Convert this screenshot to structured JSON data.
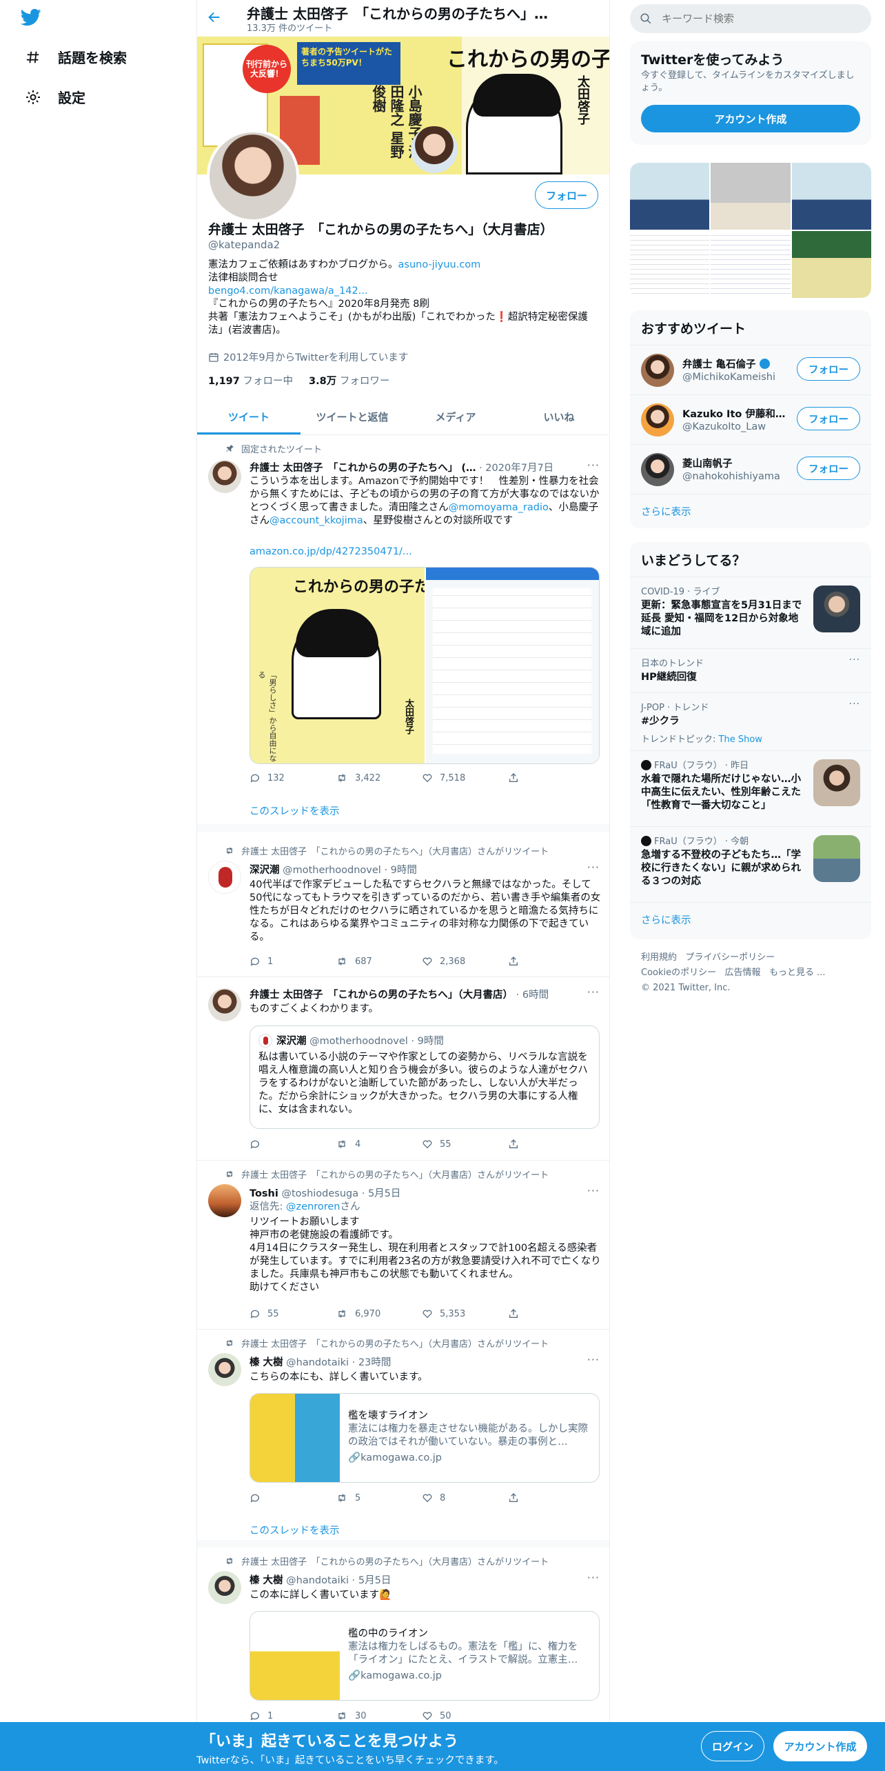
{
  "nav": {
    "explore_label": "話題を検索",
    "settings_label": "設定"
  },
  "header": {
    "title": "弁護士 太田啓子　「これからの男の子たちへ」…",
    "tweet_count": "13.3万 件のツイート"
  },
  "banner": {
    "big_title": "これからの男の子たちへ",
    "badge_text": "刊行前から大反響！",
    "badge2": "著者の予告ツイートがたちまち50万PV！",
    "names": [
      "小島慶子",
      "清田隆之",
      "星野俊樹",
      "太田啓子"
    ]
  },
  "profile": {
    "name": "弁護士 太田啓子　「これからの男の子たちへ」（大月書店）",
    "handle": "@katepanda2",
    "follow_label": "フォロー",
    "bio_line1": "憲法カフェご依頼はあすわかブログから。",
    "bio_link1": "asuno-jiyuu.com",
    "bio_line2": "法律相談問合せ",
    "bio_link2": "bengo4.com/kanagawa/a_142...",
    "bio_line3": "『これからの男の子たちへ』2020年8月発売 8刷",
    "bio_line4": "共著「憲法カフェへようこそ」(かもがわ出版)「これでわかった❗超訳特定秘密保護法」(岩波書店)。",
    "joined": "2012年9月からTwitterを利用しています",
    "following_count": "1,197",
    "following_label": "フォロー中",
    "followers_count": "3.8万",
    "followers_label": "フォロワー"
  },
  "tabs": [
    "ツイート",
    "ツイートと返信",
    "メディア",
    "いいね"
  ],
  "tweets": [
    {
      "context": "固定されたツイート",
      "name": "弁護士 太田啓子　「これからの男の子たちへ」 (…",
      "time": "· 2020年7月7日",
      "text1": "こういう本を出します。Amazonで予約開始中です！　性差別・性暴力を社会から無くすためには、子どもの頃からの男の子の育て方が大事なのではないかとつくづく思って書きました。清田隆之さん",
      "mention1": "@momoyama_radio",
      "text2": "、小島慶子さん",
      "mention2": "@account_kkojima",
      "text3": "、星野俊樹さんとの対談所収です",
      "link": "amazon.co.jp/dp/4272350471/...",
      "img_title": "これからの男の子たちへ",
      "img_side": "「男らしさ」から自由になる",
      "img_author": "太田啓子",
      "replies": "132",
      "retweets": "3,422",
      "likes": "7,518",
      "show_thread": "このスレッドを表示"
    },
    {
      "context": "弁護士 太田啓子　「これからの男の子たちへ」（大月書店）さんがリツイート",
      "name": "深沢潮",
      "handle": "@motherhoodnovel · 9時間",
      "text": "40代半ばで作家デビューした私ですらセクハラと無縁ではなかった。そして50代になってもトラウマを引きずっているのだから、若い書き手や編集者の女性たちが日々どれだけのセクハラに晒されているかを思うと暗澹たる気持ちになる。これはあらゆる業界やコミュニティの非対称な力関係の下で起きている。",
      "replies": "1",
      "retweets": "687",
      "likes": "2,368"
    },
    {
      "name": "弁護士 太田啓子　「これからの男の子たちへ」（大月書店）",
      "time": "· 6時間",
      "text": "ものすごくよくわかります。",
      "quote_name": "深沢潮",
      "quote_handle": "@motherhoodnovel · 9時間",
      "quote_text": "私は書いている小説のテーマや作家としての姿勢から、リベラルな言説を唱え人権意識の高い人と知り合う機会が多い。彼らのような人達がセクハラをするわけがないと油断していた節があったし、しない人が大半だった。だから余計にショックが大きかった。セクハラ男の大事にする人権に、女は含まれない。",
      "replies": "",
      "retweets": "4",
      "likes": "55"
    },
    {
      "context": "弁護士 太田啓子　「これからの男の子たちへ」（大月書店）さんがリツイート",
      "name": "Toshi",
      "handle": "@toshiodesuga · 5月5日",
      "reply_to_label": "返信先: ",
      "reply_to": "@zenroren",
      "reply_suffix": "さん",
      "text": "リツイートお願いします\n神戸市の老健施設の看護師です。\n4月14日にクラスター発生し、現在利用者とスタッフで計100名超える感染者が発生しています。すでに利用者23名の方が救急要請受け入れ不可で亡くなりました。兵庫県も神戸市もこの状態でも動いてくれません。\n助けてください",
      "replies": "55",
      "retweets": "6,970",
      "likes": "5,353"
    },
    {
      "context": "弁護士 太田啓子　「これからの男の子たちへ」（大月書店）さんがリツイート",
      "name": "榛 大樹",
      "handle": "@handotaiki · 23時間",
      "text": "こちらの本にも、詳しく書いています。",
      "card_title": "檻を壊すライオン",
      "card_desc": "憲法には権力を暴走させない機能がある。しかし実際の政治ではそれが働いていない。暴走の事例と…",
      "card_link": "kamogawa.co.jp",
      "replies": "",
      "retweets": "5",
      "likes": "8",
      "show_thread": "このスレッドを表示"
    },
    {
      "context": "弁護士 太田啓子　「これからの男の子たちへ」（大月書店）さんがリツイート",
      "name": "榛 大樹",
      "handle": "@handotaiki · 5月5日",
      "text": "この本に詳しく書いています🙋",
      "card_title": "檻の中のライオン",
      "card_desc": "憲法は権力をしばるもの。憲法を「檻」に、権力を「ライオン」にたとえ、イラストで解説。立憲主…",
      "card_link": "kamogawa.co.jp",
      "replies": "1",
      "retweets": "30",
      "likes": "50"
    }
  ],
  "right": {
    "search_placeholder": "キーワード検索",
    "signup_title": "Twitterを使ってみよう",
    "signup_desc": "今すぐ登録して、タイムラインをカスタマイズしましょう。",
    "signup_button": "アカウント作成",
    "rec_title": "おすすめツイート",
    "recs": [
      {
        "name": "弁護士 亀石倫子",
        "handle": "@MichikoKameishi",
        "follow": "フォロー"
      },
      {
        "name": "Kazuko Ito 伊藤和子…",
        "handle": "@KazukoIto_Law",
        "follow": "フォロー"
      },
      {
        "name": "菱山南帆子",
        "handle": "@nahokohishiyama",
        "follow": "フォロー"
      }
    ],
    "show_more": "さらに表示",
    "trends_title": "いまどうしてる？",
    "trends": [
      {
        "meta": "COVID-19 · ライブ",
        "name": "更新：緊急事態宣言を5月31日まで延長 愛知・福岡を12日から対象地域に追加"
      },
      {
        "meta": "日本のトレンド",
        "name": "HP継続回復"
      },
      {
        "meta": "J-POP · トレンド",
        "name": "#少クラ",
        "sub": "トレンドトピック: ",
        "sub_link": "The Show"
      },
      {
        "meta": "FRaU（フラウ） · 昨日",
        "name": "水着で隠れた場所だけじゃない…小中高生に伝えたい、性別年齢こえた「性教育で一番大切なこと」"
      },
      {
        "meta": "FRaU（フラウ） · 今朝",
        "name": "急増する不登校の子どもたち…「学校に行きたくない」に親が求められる３つの対応"
      }
    ],
    "footer_links": [
      "利用規約",
      "プライバシーポリシー",
      "Cookieのポリシー",
      "広告情報",
      "もっと見る ..."
    ],
    "copyright": "© 2021 Twitter, Inc."
  },
  "bottom": {
    "title": "「いま」起きていることを見つけよう",
    "subtitle": "Twitterなら、「いま」起きていることをいち早くチェックできます。",
    "login": "ログイン",
    "signup": "アカウント作成"
  },
  "colors": {
    "accent": "#1b95e0",
    "text": "#0f1419",
    "secondary": "#5b7083"
  }
}
